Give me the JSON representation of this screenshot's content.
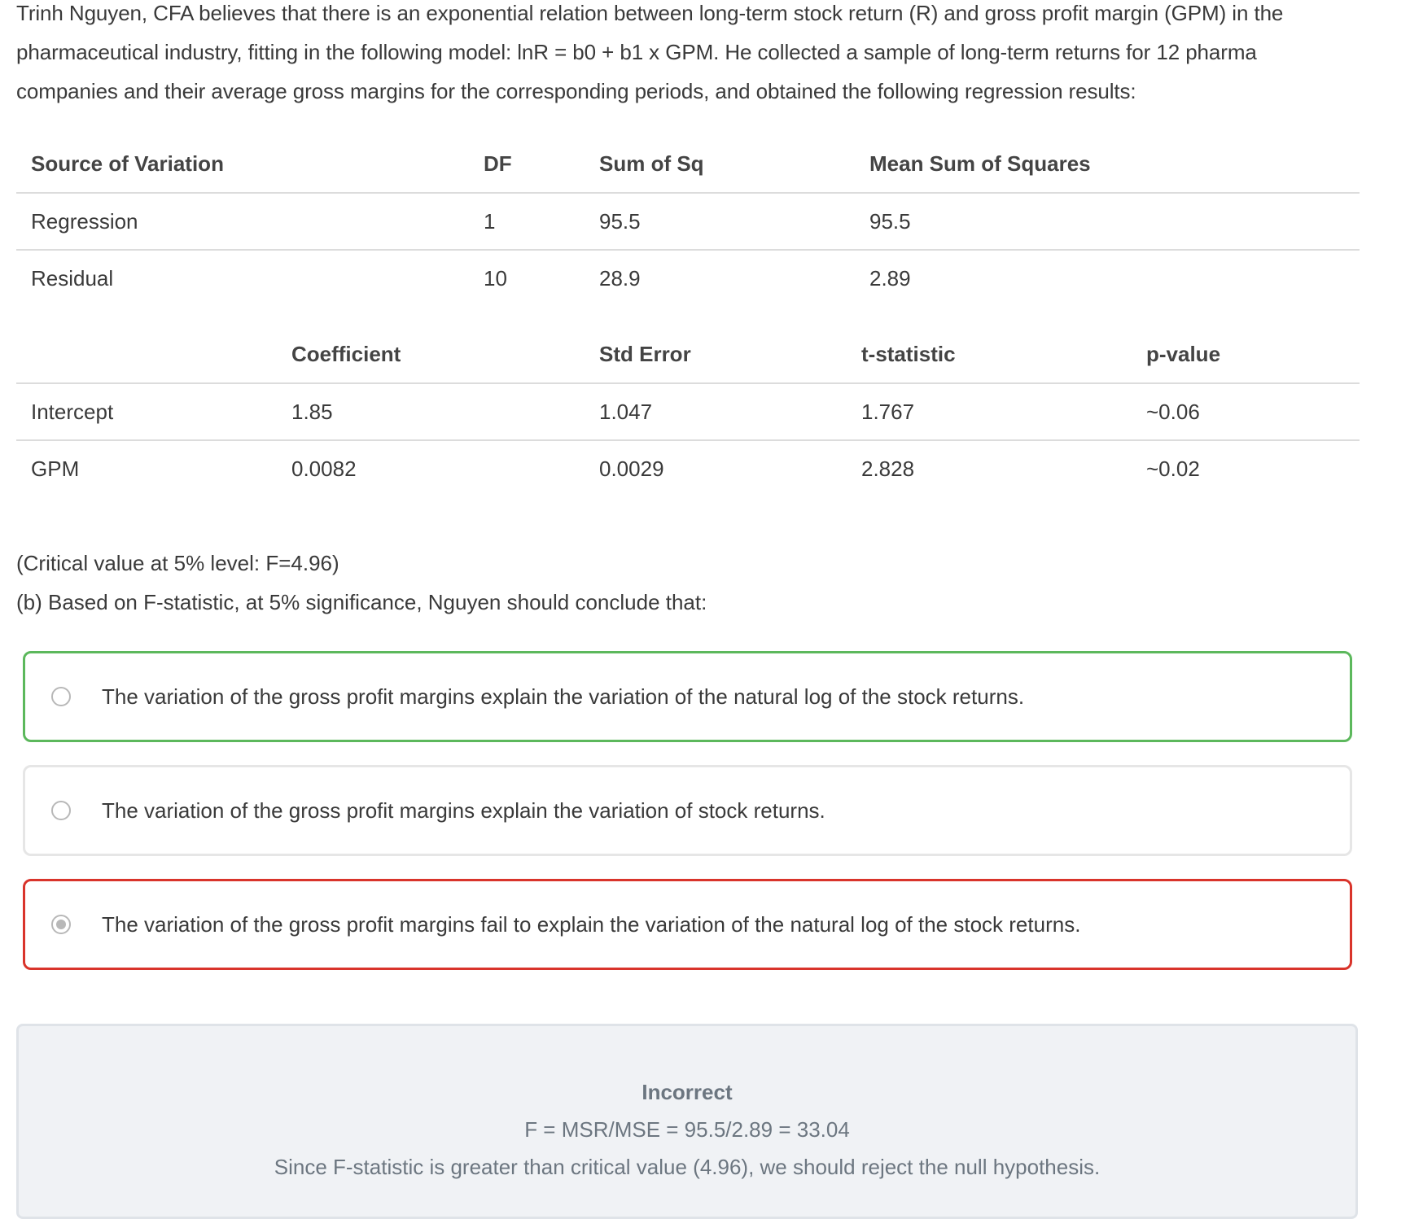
{
  "question": {
    "intro": "Trinh Nguyen, CFA believes that there is an exponential relation between long-term stock return (R) and gross profit margin (GPM) in the pharmaceutical industry, fitting in the following model: lnR = b0 + b1 x GPM. He collected a sample of long-term returns for 12 pharma companies and their average gross margins for the corresponding periods, and obtained the following regression results:",
    "critical_value": "(Critical value at 5% level: F=4.96)",
    "prompt": "(b) Based on F-statistic, at 5% significance, Nguyen should conclude that:"
  },
  "anova_table": {
    "headers": [
      "Source of Variation",
      "DF",
      "Sum of Sq",
      "Mean Sum of Squares"
    ],
    "rows": [
      [
        "Regression",
        "1",
        "95.5",
        "95.5"
      ],
      [
        "Residual",
        "10",
        "28.9",
        "2.89"
      ]
    ]
  },
  "coef_table": {
    "headers": [
      "",
      "Coefficient",
      "Std Error",
      "t-statistic",
      "p-value"
    ],
    "rows": [
      [
        "Intercept",
        "1.85",
        "1.047",
        "1.767",
        "~0.06"
      ],
      [
        "GPM",
        "0.0082",
        "0.0029",
        "2.828",
        "~0.02"
      ]
    ]
  },
  "options": [
    {
      "text": "The variation of the gross profit margins explain the variation of the natural log of the stock returns.",
      "state": "correct",
      "selected": false
    },
    {
      "text": "The variation of the gross profit margins explain the variation of stock returns.",
      "state": "neutral",
      "selected": false
    },
    {
      "text": "The variation of the gross profit margins fail to explain the variation of the natural log of the stock returns.",
      "state": "wrong",
      "selected": true
    }
  ],
  "feedback": {
    "status": "Incorrect",
    "line1": "F = MSR/MSE = 95.5/2.89 = 33.04",
    "line2": "Since F-statistic is greater than critical value (4.96), we should reject the null hypothesis."
  },
  "colors": {
    "correct_border": "#5cb85c",
    "wrong_border": "#d9342b",
    "feedback_bg": "#f0f2f5"
  }
}
